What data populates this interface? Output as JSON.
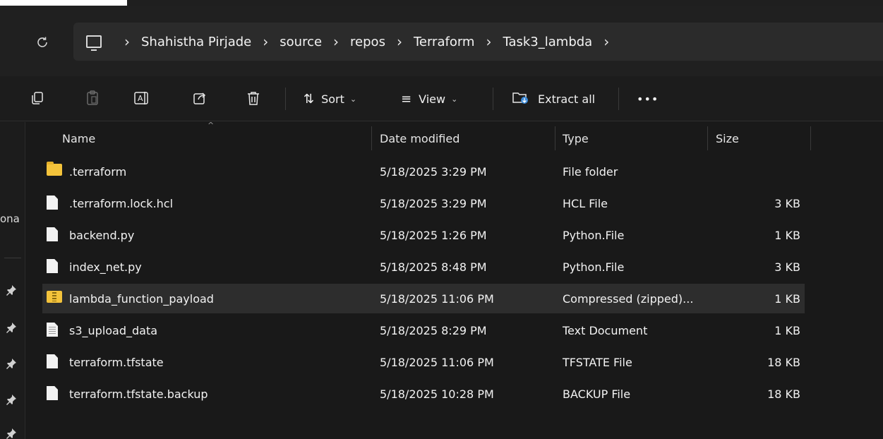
{
  "breadcrumbs": [
    "Shahistha Pirjade",
    "source",
    "repos",
    "Terraform",
    "Task3_lambda"
  ],
  "toolbar": {
    "sort_label": "Sort",
    "view_label": "View",
    "extract_label": "Extract all",
    "more_label": "•••"
  },
  "columns": {
    "name": "Name",
    "date": "Date modified",
    "type": "Type",
    "size": "Size"
  },
  "left_fragment": "ona",
  "files": [
    {
      "name": ".terraform",
      "date": "5/18/2025 3:29 PM",
      "type": "File folder",
      "size": "",
      "icon": "folder-icon"
    },
    {
      "name": ".terraform.lock.hcl",
      "date": "5/18/2025 3:29 PM",
      "type": "HCL File",
      "size": "3 KB",
      "icon": "file-icon"
    },
    {
      "name": "backend.py",
      "date": "5/18/2025 1:26 PM",
      "type": "Python.File",
      "size": "1 KB",
      "icon": "file-icon"
    },
    {
      "name": "index_net.py",
      "date": "5/18/2025 8:48 PM",
      "type": "Python.File",
      "size": "3 KB",
      "icon": "file-icon"
    },
    {
      "name": "lambda_function_payload",
      "date": "5/18/2025 11:06 PM",
      "type": "Compressed (zipped)...",
      "size": "1 KB",
      "icon": "zip-folder-icon",
      "selected": true
    },
    {
      "name": "s3_upload_data",
      "date": "5/18/2025 8:29 PM",
      "type": "Text Document",
      "size": "1 KB",
      "icon": "text-file-icon"
    },
    {
      "name": "terraform.tfstate",
      "date": "5/18/2025 11:06 PM",
      "type": "TFSTATE File",
      "size": "18 KB",
      "icon": "file-icon"
    },
    {
      "name": "terraform.tfstate.backup",
      "date": "5/18/2025 10:28 PM",
      "type": "BACKUP File",
      "size": "18 KB",
      "icon": "file-icon"
    }
  ]
}
